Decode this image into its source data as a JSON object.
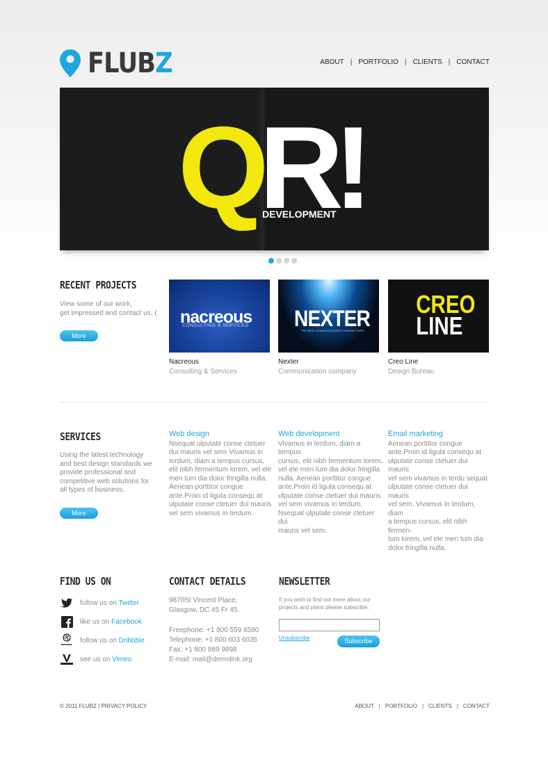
{
  "logo": {
    "prefix": "FLUB",
    "accent": "Z"
  },
  "nav": [
    {
      "label": "ABOUT"
    },
    {
      "label": "PORTFOLIO"
    },
    {
      "label": "CLIENTS"
    },
    {
      "label": "CONTACT"
    }
  ],
  "nav_separator": "|",
  "slider": {
    "title_q": "Q",
    "title_rest": "R!",
    "caption": "DEVELOPMENT",
    "slides_total": 4,
    "active_slide": 1
  },
  "recent": {
    "heading": "RECENT PROJECTS",
    "text_line1": "View some of our work,",
    "text_line2": "get impressed and contact us. (:",
    "button": "More",
    "projects": [
      {
        "name": "Nacreous",
        "desc": "Consulting & Services",
        "logo_word": "nacreous",
        "logo_sub": "CONSULTING & SERVICES"
      },
      {
        "name": "Nexter",
        "desc": "Communication company",
        "logo_word": "NEXTER",
        "logo_sub": "THE BEST COMMUNICATIONS COMPANY EVER"
      },
      {
        "name": "Creo Line",
        "desc": "Design Bureau",
        "logo_line1": "CREO",
        "logo_line2": "LINE"
      }
    ]
  },
  "services": {
    "heading": "SERVICES",
    "intro": [
      "Using the latest technology",
      "and best design standards we",
      "provide professional and",
      "competitive web solutions for",
      "all types of business."
    ],
    "button": "More",
    "items": [
      {
        "title": "Web design",
        "lines": [
          "Nsequat ulputate conse ctetuer",
          "dui mauris vel sem Vivamus in",
          "terdum, diam a tempus cursus,",
          "elit nibh fermentum lorem, vel ele",
          "men tum dia dolor fringilla nulla.",
          "Aenean porttitor congue",
          "ante.Proin id ligula consequ at",
          "ulputate conse ctetuer dui mauris",
          "vel sem vivamus in terdum."
        ]
      },
      {
        "title": "Web development",
        "lines": [
          "Vivamus in terdum, diam a tempus",
          "cursus, elit nibh fermentum lorem,",
          "vel ele men tum dia dolor fringilla",
          "nulla. Aenean porttitor congue",
          "ante.Proin id ligula consequ at",
          "ulputate conse ctetuer dui mauris",
          "vel sem vivamus in terdum.",
          "Nsequat ulputate conse ctetuer dui",
          "mauris vel sem."
        ]
      },
      {
        "title": "Email marketing",
        "lines": [
          "Aenean porttitor congue",
          "ante.Proin id ligula consequ at",
          "ulputate conse ctetuer dui mauris",
          "vel sem vivamus in terdu sequat",
          "ulputate conse ctetuer dui mauris",
          "vel sem. Vivamus in terdum, diam",
          "a tempus cursus, elit nibh fermen-",
          "tum lorem, vel ele men tum dia",
          "dolor fringilla nulla."
        ]
      }
    ]
  },
  "findus": {
    "heading": "FIND US ON",
    "items": [
      {
        "text": "follow us on ",
        "link": "Twitter",
        "icon": "twitter-icon"
      },
      {
        "text": "like us on ",
        "link": "Facebook",
        "icon": "facebook-icon"
      },
      {
        "text": "follow us on ",
        "link": "Dribbble",
        "icon": "dribbble-icon"
      },
      {
        "text": "see us on ",
        "link": "Vimeo",
        "icon": "vimeo-icon"
      }
    ]
  },
  "contact": {
    "heading": "CONTACT DETAILS",
    "address1": "9870St Vincent Place,",
    "address2": "Glasgow, DC 45 Fr 45.",
    "freephone": "Freephone: +1 800 559 6580",
    "telephone": "Telephone: +1 800 603 6035",
    "fax": "Fax: +1 800 889 9898",
    "email_label": "E-mail: ",
    "email": "mail@demolink.org"
  },
  "newsletter": {
    "heading": "NEWSLETTER",
    "text1": "If you wish to find out more about our",
    "text2": "projects and plans please subscribe.",
    "input_value": "",
    "unsubscribe": "Unsubscribe",
    "subscribe": "Subscribe"
  },
  "footer": {
    "copyright": "© 2011 FLUBZ | PRIVACY POLICY",
    "links": [
      {
        "label": "ABOUT"
      },
      {
        "label": "PORTFOLIO"
      },
      {
        "label": "CLIENTS"
      },
      {
        "label": "CONTACT"
      }
    ]
  },
  "colors": {
    "accent": "#20a6df",
    "yellow": "#f2e80e",
    "slider_bg": "#181818",
    "heading": "#2a2a2a"
  }
}
